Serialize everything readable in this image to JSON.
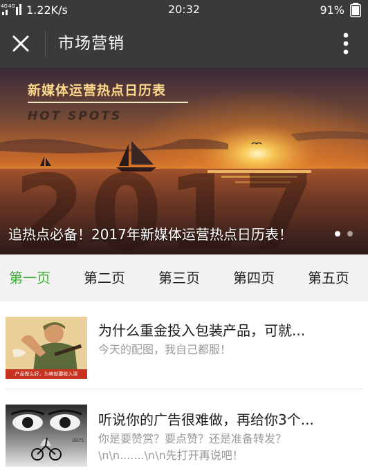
{
  "status_bar": {
    "network": "4G 4G",
    "speed": "1.22K/s",
    "time": "20:32",
    "battery": "91%"
  },
  "title_bar": {
    "title": "市场营销",
    "close_icon": "close-icon",
    "more_icon": "more-vertical-icon",
    "background": "#3a3a3a"
  },
  "banner": {
    "headline": "新媒体运营热点日历表",
    "subheadline": "HOT SPOTS",
    "caption": "追热点必备！2017年新媒体运营热点日历表！",
    "big_year": "2017",
    "slides": 2,
    "active_slide": 1
  },
  "tabs": {
    "active_color": "#3cb034",
    "items": [
      {
        "label": "第一页",
        "active": true
      },
      {
        "label": "第二页",
        "active": false
      },
      {
        "label": "第三页",
        "active": false
      },
      {
        "label": "第四页",
        "active": false
      },
      {
        "label": "第五页",
        "active": false
      }
    ]
  },
  "articles": [
    {
      "title": "为什么重金投入包装产品，可就...",
      "description": "今天的配图，我自己都服！",
      "thumb_caption": "产品做么好，为啥就要投入哭"
    },
    {
      "title": "听说你的广告很难做，再给你3个...",
      "description": "你是要赞赏？要点赞？还是准备转发？\\n\\n.......\\n\\n先打开再说吧！",
      "thumb_caption": "0871"
    }
  ]
}
